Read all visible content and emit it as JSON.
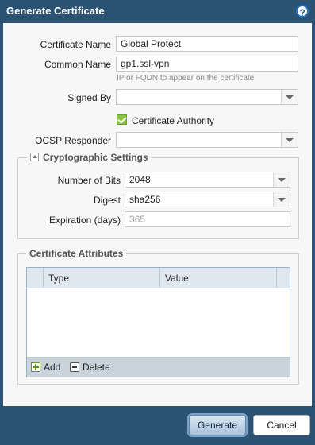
{
  "dialog": {
    "title": "Generate Certificate",
    "help_icon": "?"
  },
  "form": {
    "certificate_name": {
      "label": "Certificate Name",
      "value": "Global Protect"
    },
    "common_name": {
      "label": "Common Name",
      "value": "gp1.ssl-vpn",
      "hint": "IP or FQDN to appear on the certificate"
    },
    "signed_by": {
      "label": "Signed By",
      "value": ""
    },
    "certificate_authority": {
      "label": "Certificate Authority",
      "checked": true
    },
    "ocsp_responder": {
      "label": "OCSP Responder",
      "value": ""
    }
  },
  "crypto": {
    "legend": "Cryptographic Settings",
    "number_of_bits": {
      "label": "Number of Bits",
      "value": "2048"
    },
    "digest": {
      "label": "Digest",
      "value": "sha256"
    },
    "expiration": {
      "label": "Expiration (days)",
      "placeholder": "365"
    }
  },
  "attributes": {
    "legend": "Certificate Attributes",
    "columns": [
      "Type",
      "Value"
    ],
    "rows": [],
    "add_label": "Add",
    "delete_label": "Delete"
  },
  "buttons": {
    "generate": "Generate",
    "cancel": "Cancel"
  },
  "colors": {
    "titlebar": "#2c5373",
    "panel": "#f7f7f7",
    "checkbox": "#8cc63f"
  }
}
